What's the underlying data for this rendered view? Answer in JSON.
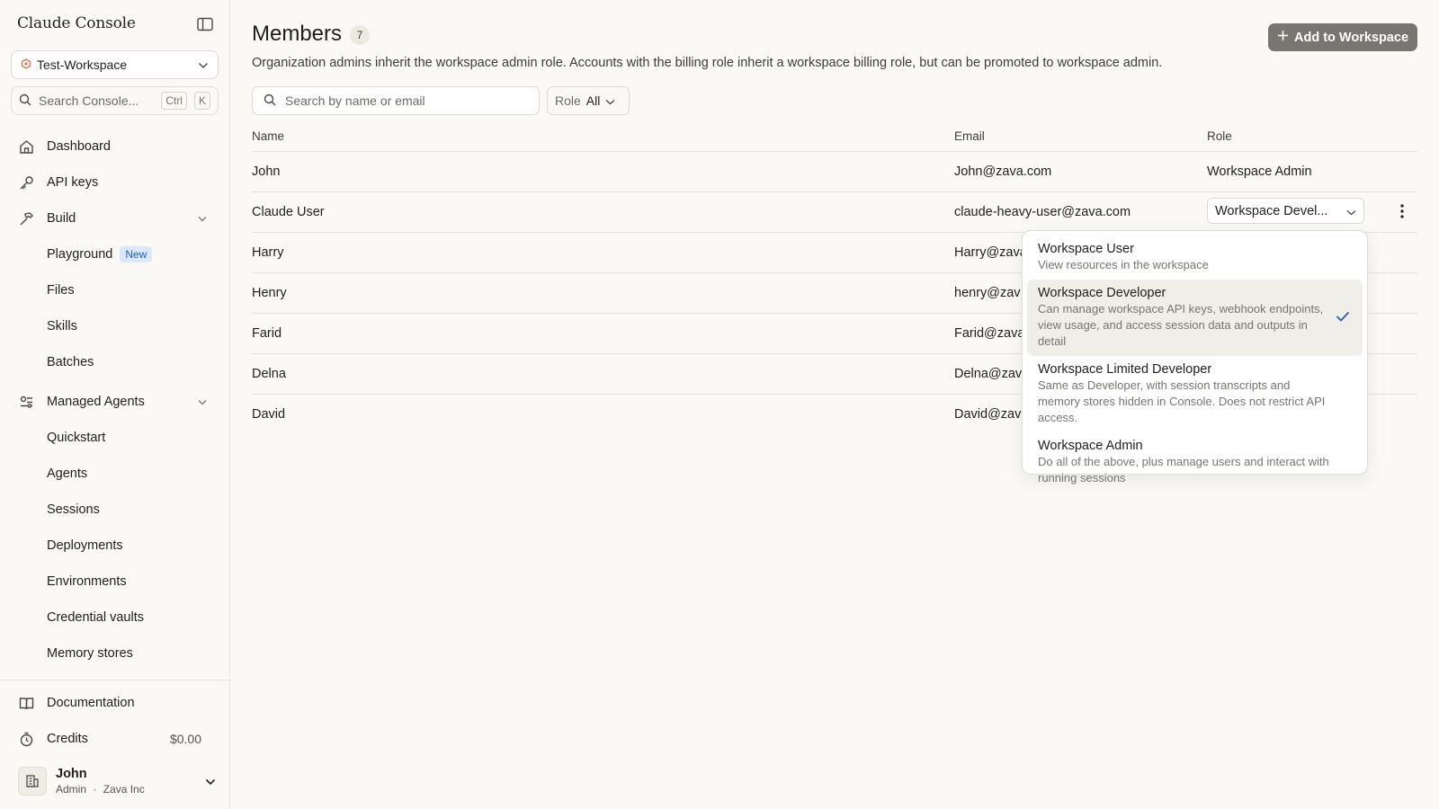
{
  "app": {
    "title": "Claude Console"
  },
  "sidebar": {
    "workspace": "Test-Workspace",
    "search": {
      "placeholder": "Search Console...",
      "kbd1": "Ctrl",
      "kbd2": "K"
    },
    "nav": {
      "dashboard": "Dashboard",
      "api_keys": "API keys",
      "build": "Build",
      "playground": "Playground",
      "playground_badge": "New",
      "files": "Files",
      "skills": "Skills",
      "batches": "Batches",
      "managed_agents": "Managed Agents",
      "quickstart": "Quickstart",
      "agents": "Agents",
      "sessions": "Sessions",
      "deployments": "Deployments",
      "environments": "Environments",
      "credential_vaults": "Credential vaults",
      "memory_stores": "Memory stores",
      "documentation": "Documentation",
      "credits": "Credits",
      "credits_value": "$0.00"
    },
    "user": {
      "name": "John",
      "role": "Admin",
      "separator": "·",
      "org": "Zava Inc"
    }
  },
  "main": {
    "title": "Members",
    "count": "7",
    "subtitle": "Organization admins inherit the workspace admin role. Accounts with the billing role inherit a workspace billing role, but can be promoted to workspace admin.",
    "add_button": "Add to Workspace",
    "search_placeholder": "Search by name or email",
    "role_filter": {
      "label": "Role",
      "value": "All"
    },
    "columns": {
      "name": "Name",
      "email": "Email",
      "role": "Role"
    },
    "rows": [
      {
        "name": "John",
        "email": "John@zava.com",
        "role": "Workspace Admin"
      },
      {
        "name": "Claude User",
        "email": "claude-heavy-user@zava.com",
        "role": "Workspace Devel..."
      },
      {
        "name": "Harry",
        "email": "Harry@zava"
      },
      {
        "name": "Henry",
        "email": "henry@zav"
      },
      {
        "name": "Farid",
        "email": "Farid@zava"
      },
      {
        "name": "Delna",
        "email": "Delna@zav"
      },
      {
        "name": "David",
        "email": "David@zav"
      }
    ]
  },
  "role_dropdown": {
    "options": [
      {
        "title": "Workspace User",
        "desc": "View resources in the workspace"
      },
      {
        "title": "Workspace Developer",
        "desc": "Can manage workspace API keys, webhook endpoints, view usage, and access session data and outputs in detail",
        "selected": true
      },
      {
        "title": "Workspace Limited Developer",
        "desc": "Same as Developer, with session transcripts and memory stores hidden in Console. Does not restrict API access."
      },
      {
        "title": "Workspace Admin",
        "desc": "Do all of the above, plus manage users and interact with running sessions"
      }
    ]
  },
  "colors": {
    "accent_check": "#2a5db0",
    "badge_bg": "#dbe8fb",
    "badge_text": "#1d5fc4",
    "button_bg": "#787670",
    "workspace_icon": "#d97757"
  }
}
